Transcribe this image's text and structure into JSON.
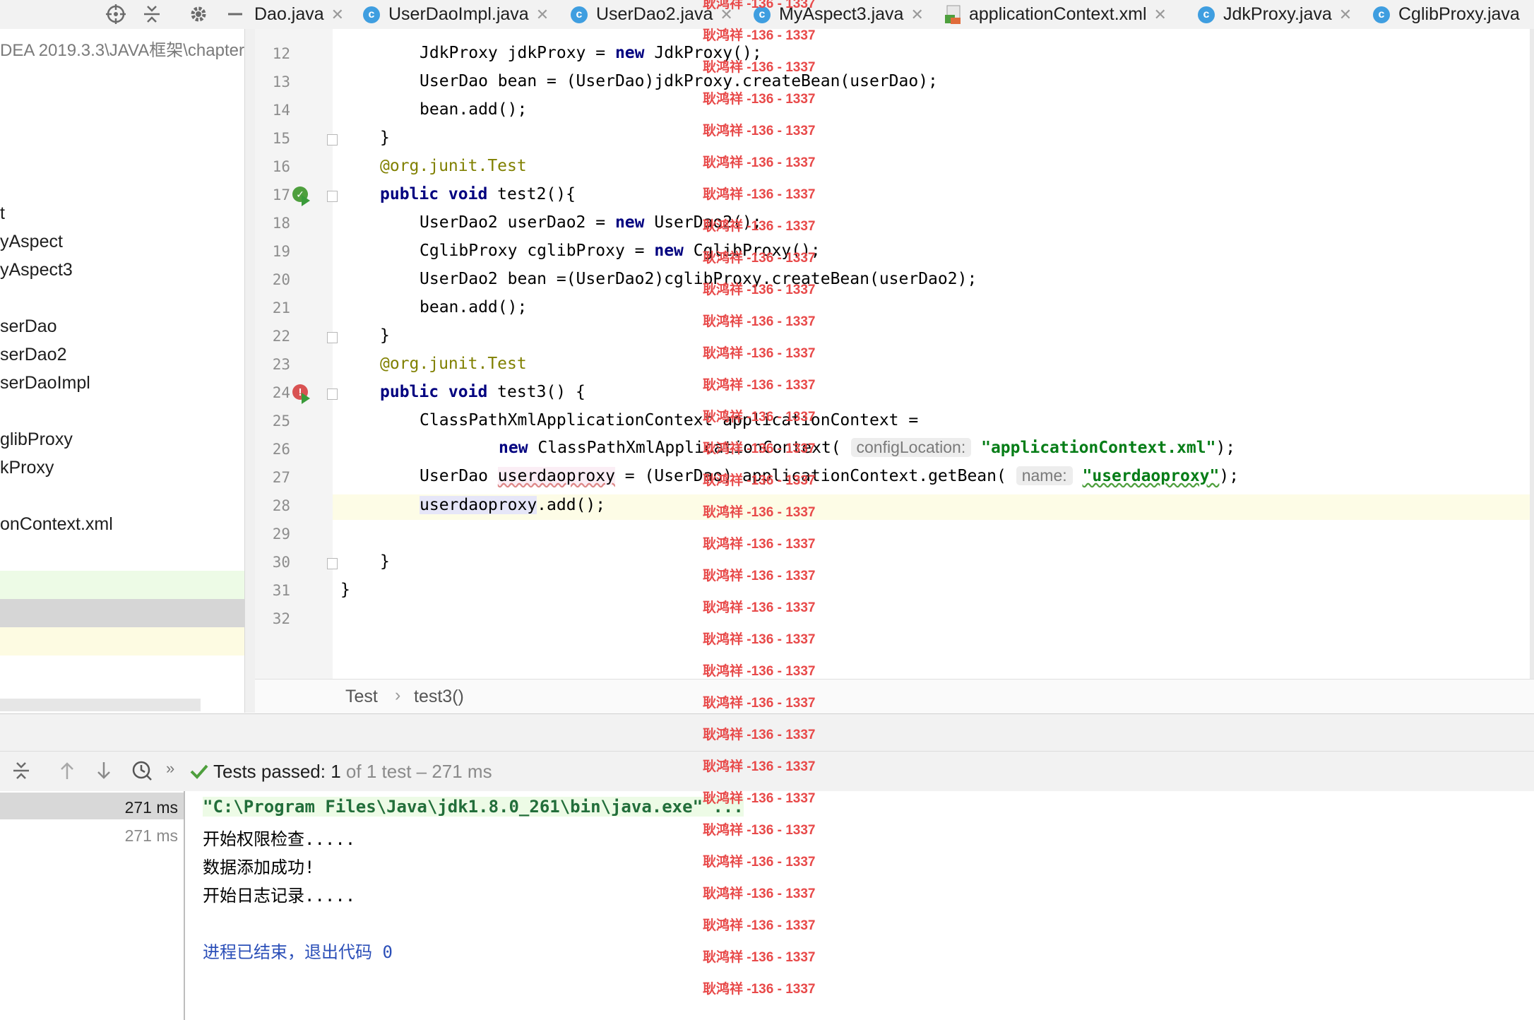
{
  "tabs": [
    {
      "label": "Dao.java",
      "icon": "none"
    },
    {
      "label": "UserDaoImpl.java",
      "icon": "class-icon"
    },
    {
      "label": "UserDao2.java",
      "icon": "class-icon"
    },
    {
      "label": "MyAspect3.java",
      "icon": "class-icon"
    },
    {
      "label": "applicationContext.xml",
      "icon": "xml-icon"
    },
    {
      "label": "JdkProxy.java",
      "icon": "class-icon"
    },
    {
      "label": "CglibProxy.java",
      "icon": "class-icon"
    }
  ],
  "project": {
    "path": "DEA 2019.3.3\\JAVA框架\\chapter",
    "items": [
      "t",
      "yAspect",
      "yAspect3",
      "serDao",
      "serDao2",
      "serDaoImpl",
      "glibProxy",
      "kProxy",
      "onContext.xml"
    ]
  },
  "code": {
    "line_numbers": [
      "12",
      "13",
      "14",
      "15",
      "16",
      "17",
      "18",
      "19",
      "20",
      "21",
      "22",
      "23",
      "24",
      "25",
      "26",
      "27",
      "28",
      "29",
      "30",
      "31",
      "32"
    ],
    "l12": {
      "a": "JdkProxy jdkProxy = ",
      "b": "new",
      "c": " JdkProxy();"
    },
    "l13": "UserDao bean = (UserDao)jdkProxy.createBean(userDao);",
    "l14": "bean.add();",
    "l15": "}",
    "l16": {
      "at": "@org.junit.",
      "ann": "Test"
    },
    "l17": {
      "kw": "public void",
      "rest": " test2(){"
    },
    "l18": {
      "a": "UserDao2 userDao2 = ",
      "b": "new",
      "c": " UserDao2();"
    },
    "l19": {
      "a": "CglibProxy cglibProxy = ",
      "b": "new",
      "c": " CglibProxy();"
    },
    "l20": "UserDao2 bean =(UserDao2)cglibProxy.createBean(userDao2);",
    "l21": "bean.add();",
    "l22": "}",
    "l23": {
      "at": "@org.junit.",
      "ann": "Test"
    },
    "l24": {
      "kw": "public void",
      "rest": " test3() {"
    },
    "l25": "ClassPathXmlApplicationContext applicationContext =",
    "l26": {
      "kw": "new",
      "rest": " ClassPathXmlApplicationContext(",
      "hint": "configLocation:",
      "str": "\"applicationContext.xml\"",
      "end": ");"
    },
    "l27": {
      "a": "UserDao ",
      "var": "userdaoproxy",
      "b": " = (UserDao) applicationContext.getBean(",
      "hint": "name:",
      "str": "\"userdaoproxy\"",
      "end": ");"
    },
    "l28": {
      "var": "userdaoproxy",
      "rest": ".add();"
    },
    "l30": "}",
    "l31": "}"
  },
  "breadcrumb": {
    "class": "Test",
    "sep": "›",
    "method": "test3()"
  },
  "run": {
    "status_label": "Tests passed:",
    "passed": "1",
    "of_text": "of 1 test – 271 ms",
    "tree_times": [
      "271 ms",
      "271 ms"
    ],
    "console": [
      "\"C:\\Program Files\\Java\\jdk1.8.0_261\\bin\\java.exe\" ...",
      "开始权限检查.....",
      "数据添加成功!",
      "开始日志记录.....",
      "",
      "进程已结束，退出代码 0"
    ]
  },
  "watermark": "耿鸿祥 -136 - 1337",
  "colors": {
    "keyword": "#00007f",
    "string": "#067d17",
    "annotation": "#808000",
    "current_line": "#fdfce6",
    "watermark": "#e84a4a",
    "passed": "#4e9f3d"
  }
}
